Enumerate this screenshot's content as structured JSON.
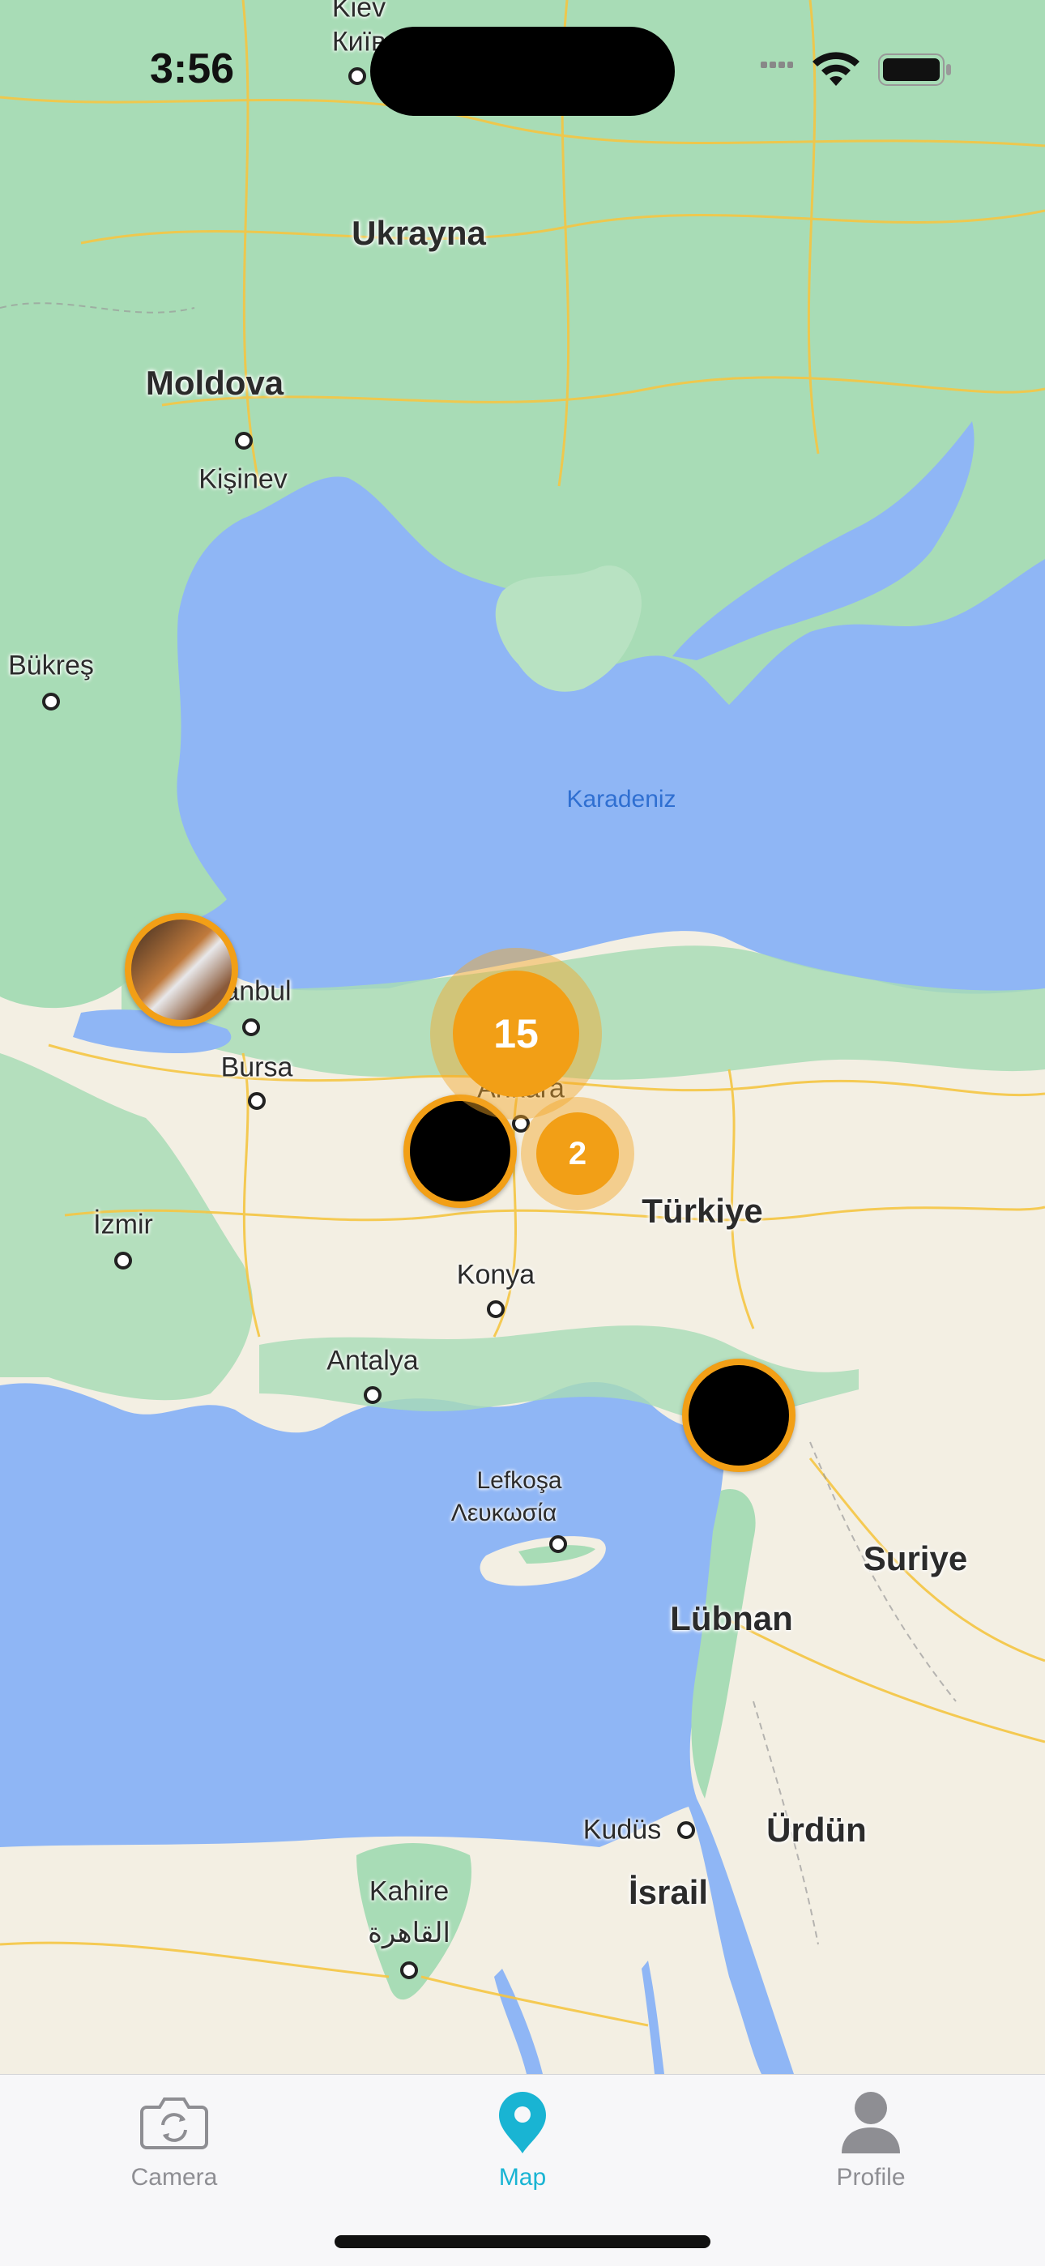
{
  "status_bar": {
    "time": "3:56"
  },
  "map": {
    "labels": {
      "kiev": "Kiev",
      "kyiv": "Київ",
      "ukraine": "Ukrayna",
      "moldova": "Moldova",
      "chisinau": "Kişinev",
      "bucharest": "Bükreş",
      "black_sea": "Karadeniz",
      "istanbul": "İstanbul",
      "bursa": "Bursa",
      "ankara": "Ankara",
      "turkey": "Türkiye",
      "izmir": "İzmir",
      "konya": "Konya",
      "antalya": "Antalya",
      "nicosia_tr": "Lefkoşa",
      "nicosia_gr": "Λευκωσία",
      "syria": "Suriye",
      "lebanon": "Lübnan",
      "jerusalem": "Kudüs",
      "jordan": "Ürdün",
      "israel": "İsrail",
      "cairo": "Kahire",
      "cairo_ar": "القاهرة"
    },
    "clusters": [
      {
        "count": "15"
      },
      {
        "count": "2"
      }
    ],
    "colors": {
      "marker_accent": "#f29f16",
      "water": "#8fb6f5",
      "land": "#a8dcb6",
      "land_south": "#f5efe2"
    }
  },
  "tab_bar": {
    "active_color": "#19b4d3",
    "inactive_color": "#8e8e93",
    "tabs": [
      {
        "label": "Camera",
        "icon": "camera-rotate-icon",
        "active": false
      },
      {
        "label": "Map",
        "icon": "map-pin-icon",
        "active": true
      },
      {
        "label": "Profile",
        "icon": "person-icon",
        "active": false
      }
    ]
  }
}
